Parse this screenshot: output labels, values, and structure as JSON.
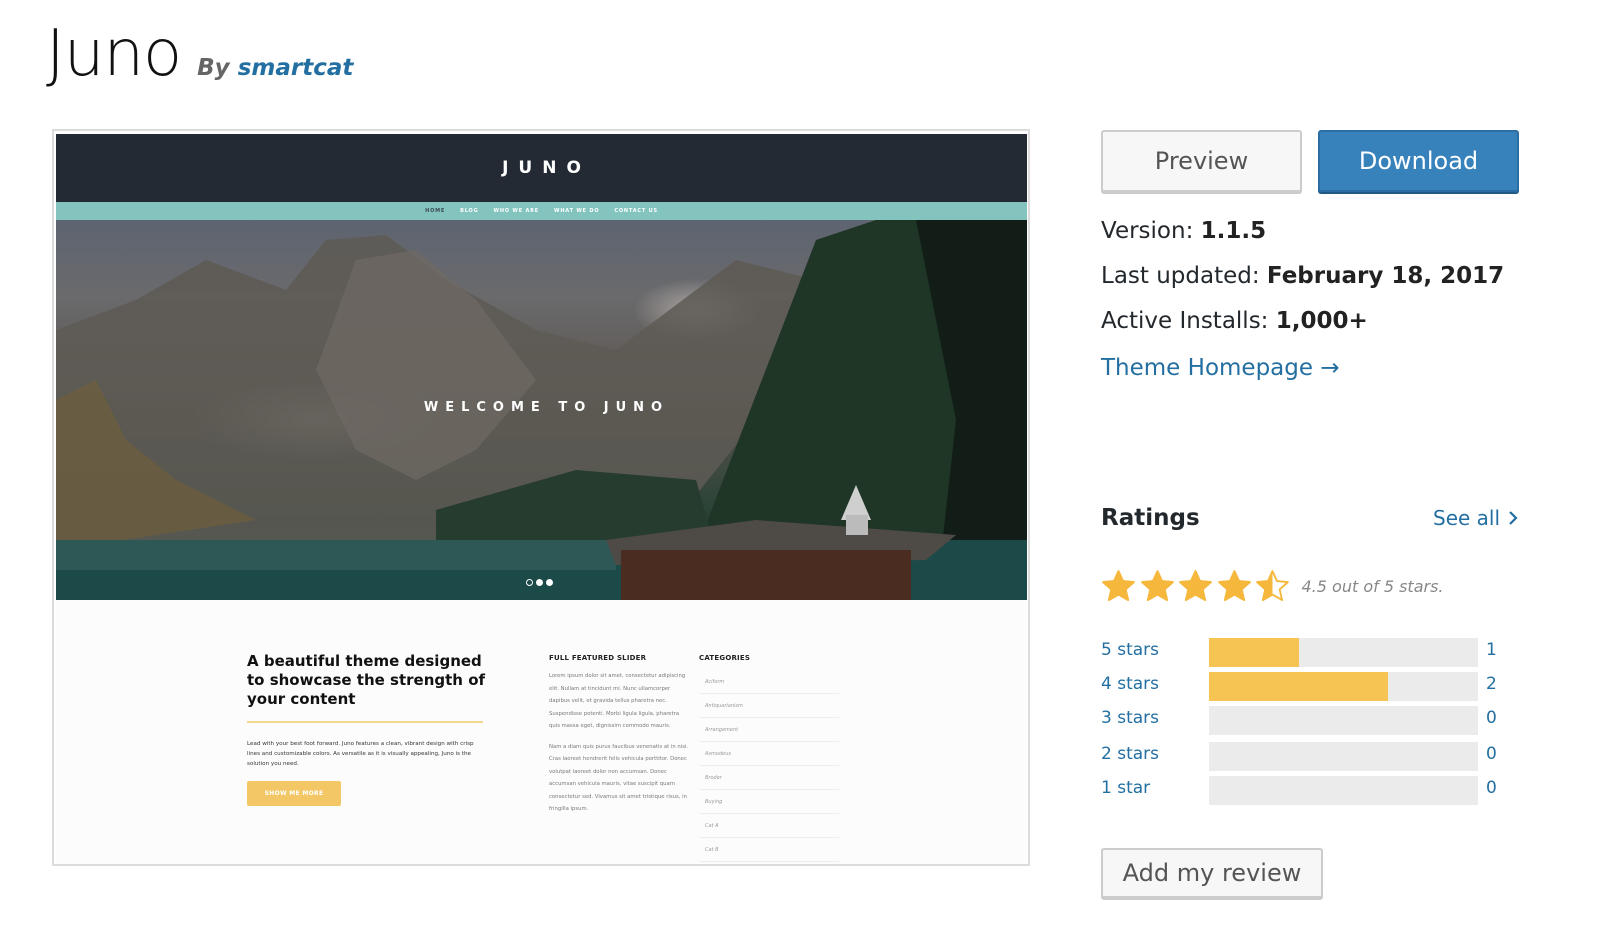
{
  "header": {
    "theme_name": "Juno",
    "by_label": "By",
    "author": "smartcat"
  },
  "screenshot": {
    "logo": "JUNO",
    "nav": [
      "HOME",
      "BLOG",
      "WHO WE ARE",
      "WHAT WE DO",
      "CONTACT US"
    ],
    "hero_title": "WELCOME TO JUNO",
    "slider_dots": 3,
    "heading": "A beautiful theme designed to showcase the strength of your content",
    "paragraph": "Lead with your best foot forward. Juno features a clean, vibrant design with crisp lines and customizable colors. As versatile as it is visually appealing, Juno is the solution you need.",
    "cta": "SHOW ME MORE",
    "col2_title": "FULL FEATURED SLIDER",
    "col2_p1": "Lorem ipsum dolor sit amet, consectetur adipiscing elit. Nullam at tincidunt mi. Nunc ullamcorper dapibus velit, et gravida tellus pharetra nec. Suspendisse potenti. Morbi ligula ligula, pharetra quis massa eget, dignissim commodo mauris.",
    "col2_p2": "Nam a diam quis purus faucibus venenatis at in nisi. Cras laoreet hendrerit felis vehicula porttitor. Donec volutpat laoreet dolor non accumsan. Donec accumsan vehicula mauris, vitae suscipit quam consectetur sed. Vivamus sit amet tristique risus, in fringilla ipsum.",
    "col3_title": "CATEGORIES",
    "categories": [
      "Aciform",
      "Antiquarianism",
      "Arrangement",
      "Asmodeus",
      "Broder",
      "Buying",
      "Cat A",
      "Cat B"
    ]
  },
  "actions": {
    "preview_label": "Preview",
    "download_label": "Download"
  },
  "meta": {
    "version_label": "Version:",
    "version": "1.1.5",
    "updated_label": "Last updated:",
    "updated": "February 18, 2017",
    "installs_label": "Active Installs:",
    "installs": "1,000+",
    "homepage_label": "Theme Homepage →"
  },
  "ratings": {
    "title": "Ratings",
    "see_all": "See all",
    "average": 4.5,
    "max": 5,
    "summary": "4.5 out of 5 stars.",
    "rows": [
      {
        "label": "5 stars",
        "count": "1",
        "fraction": 0.333
      },
      {
        "label": "4 stars",
        "count": "2",
        "fraction": 0.667
      },
      {
        "label": "3 stars",
        "count": "0",
        "fraction": 0
      },
      {
        "label": "2 stars",
        "count": "0",
        "fraction": 0
      },
      {
        "label": "1 star",
        "count": "0",
        "fraction": 0
      }
    ],
    "star_color": "#f5b83d",
    "add_review_label": "Add my review"
  },
  "colors": {
    "link": "#236fa1",
    "primary_button": "#3882bc",
    "bar_fill": "#f5c453",
    "bar_track": "#ebebeb"
  }
}
